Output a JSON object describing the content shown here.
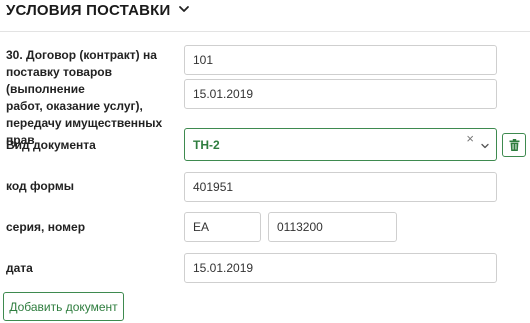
{
  "section": {
    "title": "УСЛОВИЯ ПОСТАВКИ"
  },
  "contract": {
    "label_lines": [
      "30. Договор (контракт) на",
      "поставку товаров (выполнение",
      "работ, оказание услуг),",
      "передачу имущественных прав"
    ],
    "number": "101",
    "date": "15.01.2019"
  },
  "document_type": {
    "label": "Вид документа",
    "selected": "ТН-2",
    "clear_glyph": "×"
  },
  "form_code": {
    "label": "код формы",
    "value": "401951"
  },
  "series_number": {
    "label": "серия, номер",
    "series": "ЕА",
    "number": "0113200"
  },
  "date_field": {
    "label": "дата",
    "value": "15.01.2019"
  },
  "actions": {
    "add_document_label": "Добавить документ"
  },
  "colors": {
    "accent_green": "#2e7d3e",
    "border_green": "#3e8a4f"
  }
}
